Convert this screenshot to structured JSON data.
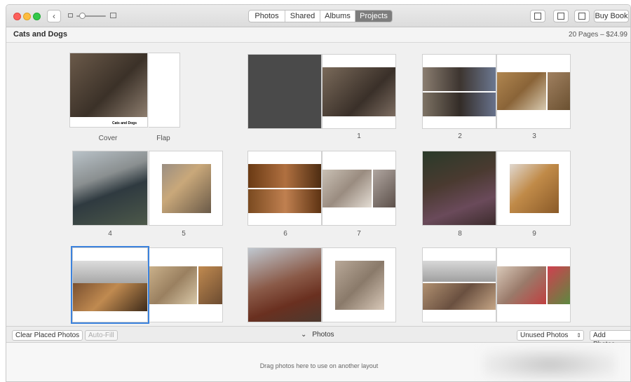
{
  "toolbar": {
    "tabs": [
      {
        "label": "Photos"
      },
      {
        "label": "Shared"
      },
      {
        "label": "Albums"
      },
      {
        "label": "Projects"
      }
    ],
    "active_tab": "Projects",
    "buy_book_label": "Buy Book"
  },
  "project": {
    "title": "Cats and Dogs",
    "summary": "20 Pages – $24.99",
    "cover_caption": "Cats and Dogs"
  },
  "spreads": [
    {
      "labels": [
        "Cover",
        "Flap"
      ]
    },
    {
      "labels": [
        "1"
      ]
    },
    {
      "labels": [
        "2",
        "3"
      ]
    },
    {
      "labels": [
        "4",
        "5"
      ]
    },
    {
      "labels": [
        "6",
        "7"
      ]
    },
    {
      "labels": [
        "8",
        "9"
      ]
    },
    {
      "labels": [],
      "selected": true
    },
    {
      "labels": []
    },
    {
      "labels": []
    }
  ],
  "bottombar": {
    "clear_label": "Clear Placed Photos",
    "autofill_label": "Auto-Fill",
    "photos_toggle_label": "Photos",
    "filter_value": "Unused Photos",
    "add_photos_label": "Add Photos"
  },
  "drop_area": {
    "hint": "Drag photos here to use on another layout"
  },
  "colors": {
    "selection": "#3b82dd",
    "active_tab_bg": "#7d7d7d"
  }
}
